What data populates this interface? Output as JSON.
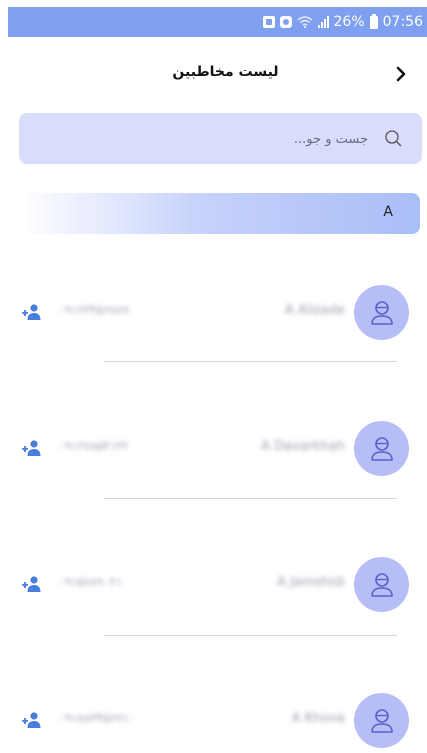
{
  "status_bar": {
    "wifi_icon": "wifi-icon",
    "signal_icon": "signal-icon",
    "battery": "26%",
    "battery_icon": "battery-icon",
    "time": "07:56",
    "bg_color": "#7f9ff1"
  },
  "header": {
    "title": "لیست مخاطبین",
    "back_icon": "chevron-right-icon"
  },
  "search": {
    "placeholder": "جست و جو...",
    "value": "",
    "icon": "search-icon"
  },
  "section": {
    "letter": "A"
  },
  "contacts": [
    {
      "name": "A Alizade",
      "phone": "۰۹۱۲۳۴۵۶۷۸۹",
      "avatar_icon": "user-icon",
      "action_icon": "add-contact-icon"
    },
    {
      "name": "A Davarkhah",
      "phone": "۰۹۱۲۷۸۵۴۱۳۲",
      "avatar_icon": "user-icon",
      "action_icon": "add-contact-icon"
    },
    {
      "name": "A Jamshidi",
      "phone": "۰۹۱۵۶۸۹۰۲۱",
      "avatar_icon": "user-icon",
      "action_icon": "add-contact-icon"
    },
    {
      "name": "A Khova",
      "phone": "۰۹۱۸۸۳۴۵۶۷۱۰",
      "avatar_icon": "user-icon",
      "action_icon": "add-contact-icon"
    }
  ],
  "colors": {
    "accent": "#7f9ff1",
    "avatar_bg": "#b7bdf7",
    "search_bg": "#d9dcfb",
    "add_icon": "#4a7de0"
  }
}
